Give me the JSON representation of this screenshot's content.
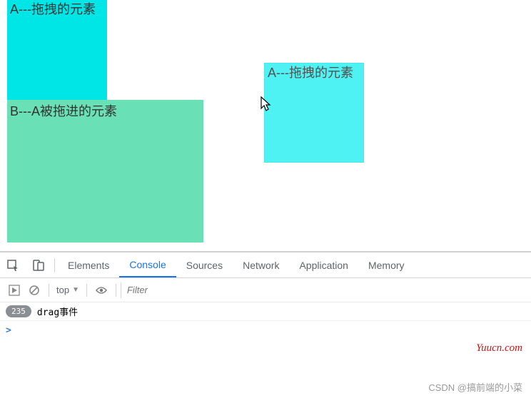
{
  "boxes": {
    "a_label": "A---拖拽的元素",
    "b_label": "B---A被拖进的元素",
    "ghost_label": "A---拖拽的元素"
  },
  "devtools": {
    "tabs": {
      "elements": "Elements",
      "console": "Console",
      "sources": "Sources",
      "network": "Network",
      "application": "Application",
      "memory": "Memory"
    },
    "toolbar": {
      "context": "top",
      "filter_placeholder": "Filter"
    },
    "log": {
      "count": "235",
      "message": "drag事件"
    },
    "prompt": ">"
  },
  "corner_link": "Yuucn.com",
  "watermark": "CSDN @搞前端的小菜"
}
